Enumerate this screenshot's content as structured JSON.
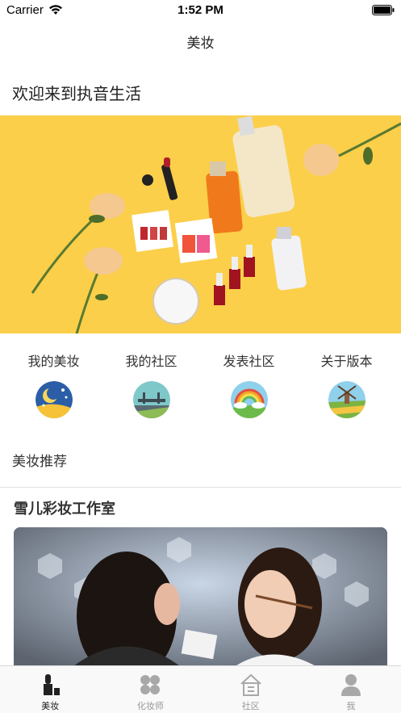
{
  "status_bar": {
    "carrier": "Carrier",
    "time": "1:52 PM"
  },
  "nav": {
    "title": "美妆"
  },
  "welcome": "欢迎来到执音生活",
  "quick_menu": [
    {
      "label": "我的美妆",
      "icon": "moon-night-icon"
    },
    {
      "label": "我的社区",
      "icon": "bridge-landscape-icon"
    },
    {
      "label": "发表社区",
      "icon": "rainbow-icon"
    },
    {
      "label": "关于版本",
      "icon": "windmill-icon"
    }
  ],
  "section_title": "美妆推荐",
  "studio": {
    "title": "雪儿彩妆工作室"
  },
  "tab_bar": [
    {
      "label": "美妆",
      "icon": "lipstick-icon",
      "active": true
    },
    {
      "label": "化妆师",
      "icon": "clover-icon",
      "active": false
    },
    {
      "label": "社区",
      "icon": "house-icon",
      "active": false
    },
    {
      "label": "我",
      "icon": "person-icon",
      "active": false
    }
  ],
  "colors": {
    "banner_bg": "#fbcf4a",
    "tab_active": "#222222",
    "tab_inactive": "#999999"
  }
}
